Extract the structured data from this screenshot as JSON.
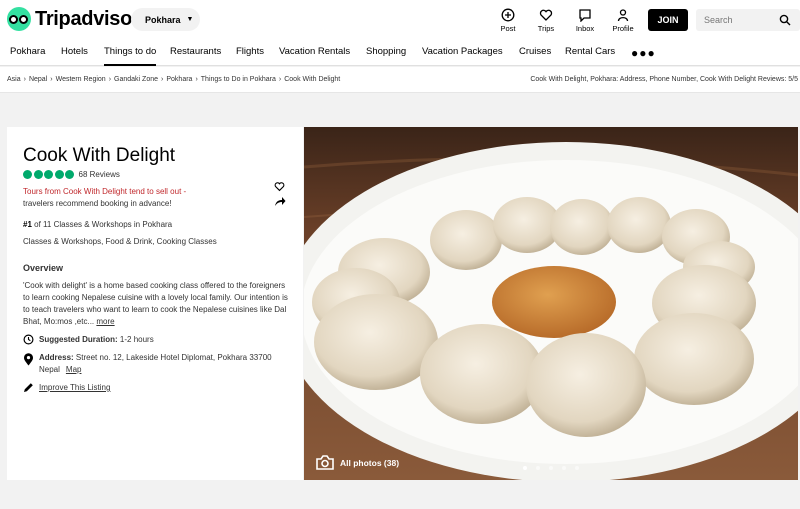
{
  "header": {
    "logo_text": "Tripadvisor",
    "geo_pill": "Pokhara",
    "nav": [
      {
        "label": "Post",
        "icon": "plus-circle-icon"
      },
      {
        "label": "Trips",
        "icon": "heart-icon"
      },
      {
        "label": "Inbox",
        "icon": "message-icon"
      },
      {
        "label": "Profile",
        "icon": "person-icon"
      }
    ],
    "join_label": "JOIN",
    "search_placeholder": "Search"
  },
  "categories": [
    "Pokhara",
    "Hotels",
    "Things to do",
    "Restaurants",
    "Flights",
    "Vacation Rentals",
    "Shopping",
    "Vacation Packages",
    "Cruises",
    "Rental Cars"
  ],
  "active_category": "Things to do",
  "breadcrumbs": [
    "Asia",
    "Nepal",
    "Western Region",
    "Gandaki Zone",
    "Pokhara",
    "Things to Do in Pokhara",
    "Cook With Delight"
  ],
  "breadcrumb_title": "Cook With Delight, Pokhara: Address, Phone Number, Cook With Delight Reviews: 5/5",
  "listing": {
    "title": "Cook With Delight",
    "rating_bubbles": 5,
    "reviews": "68 Reviews",
    "sellout_red": "Tours from Cook With Delight tend to sell out -",
    "sellout_grey": "travelers recommend booking in advance!",
    "rank_number": "#1",
    "rank_text": "of 11 Classes & Workshops in Pokhara",
    "categories_text": "Classes & Workshops, Food & Drink, Cooking Classes",
    "overview_heading": "Overview",
    "overview_text": "'Cook with delight' is a home based cooking class offered to the foreigners to learn cooking Nepalese cuisine with a lovely local family. Our intention is to teach travelers who want to learn to cook the Nepalese cuisines like Dal Bhat, Mo:mos ,etc...",
    "more_label": "more",
    "duration_label": "Suggested Duration:",
    "duration_value": "1-2 hours",
    "address_label": "Address:",
    "address_value": "Street no. 12, Lakeside Hotel Diplomat, Pokhara 33700 Nepal",
    "map_label": "Map",
    "improve_label": "Improve This Listing"
  },
  "photos": {
    "all_photos_label": "All photos (38)",
    "page_count": 5,
    "active_page": 1
  }
}
